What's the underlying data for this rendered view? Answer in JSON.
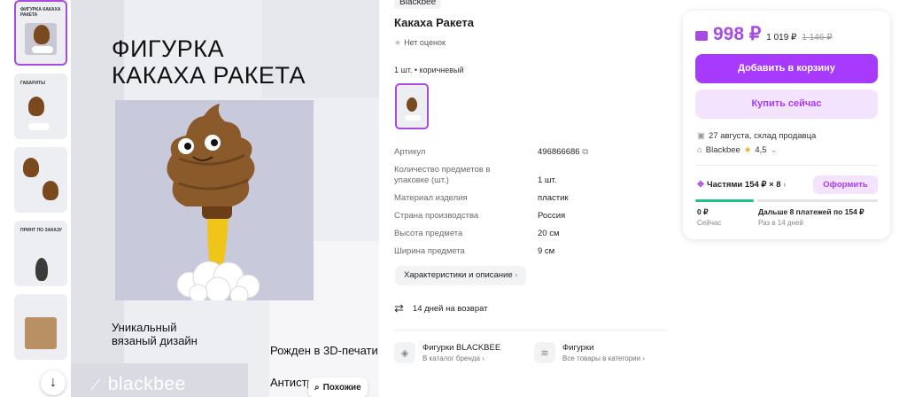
{
  "thumbnails": [
    {
      "label": "ФИГУРКА КАКАХА РАКЕТА",
      "active": true
    },
    {
      "label": "ГАБАРИТЫ",
      "active": false
    },
    {
      "label": "",
      "active": false
    },
    {
      "label": "ПРИНТ ПО ЗАКАЗУ",
      "active": false
    },
    {
      "label": "",
      "active": false
    }
  ],
  "hero": {
    "title_line1": "ФИГУРКА",
    "title_line2": "КАКАХА РАКЕТА",
    "tagline": "Уникальный вязаный дизайн",
    "printed": "Рожден в 3D-печати",
    "antistress": "Антистр",
    "logo": "blackbee",
    "similar_label": "Похожие"
  },
  "product": {
    "brand": "Blackbee",
    "title": "Какаха Ракета",
    "rating_text": "Нет оценок",
    "variant": "1 шт. • коричневый",
    "specs": [
      {
        "key": "Артикул",
        "value": "496866686"
      },
      {
        "key": "Количество предметов в упаковке (шт.)",
        "value": "1 шт."
      },
      {
        "key": "Материал изделия",
        "value": "пластик"
      },
      {
        "key": "Страна производства",
        "value": "Россия"
      },
      {
        "key": "Высота предмета",
        "value": "20 см"
      },
      {
        "key": "Ширина предмета",
        "value": "9 см"
      }
    ],
    "characteristics_button": "Характеристики и описание",
    "return_text": "14 дней на возврат",
    "categories": [
      {
        "name": "Фигурки BLACKBEE",
        "sub": "В каталог бренда"
      },
      {
        "name": "Фигурки",
        "sub": "Все товары в категории"
      }
    ]
  },
  "buy_card": {
    "price": "998 ₽",
    "price_alt": "1 019 ₽",
    "price_old": "1 146 ₽",
    "add_to_cart": "Добавить в корзину",
    "buy_now": "Купить сейчас",
    "delivery": "27 августа, склад продавца",
    "seller_name": "Blackbee",
    "seller_rating": "4,5",
    "installment_label": "Частями 154 ₽ × 8",
    "order_button": "Оформить",
    "inst_now_amount": "0 ₽",
    "inst_now_label": "Сейчас",
    "inst_later_amount": "Дальше 8 платежей по 154 ₽",
    "inst_later_label": "Раз в 14 дней",
    "accent_color": "#a73afd",
    "progress_color": "#20c08a"
  }
}
